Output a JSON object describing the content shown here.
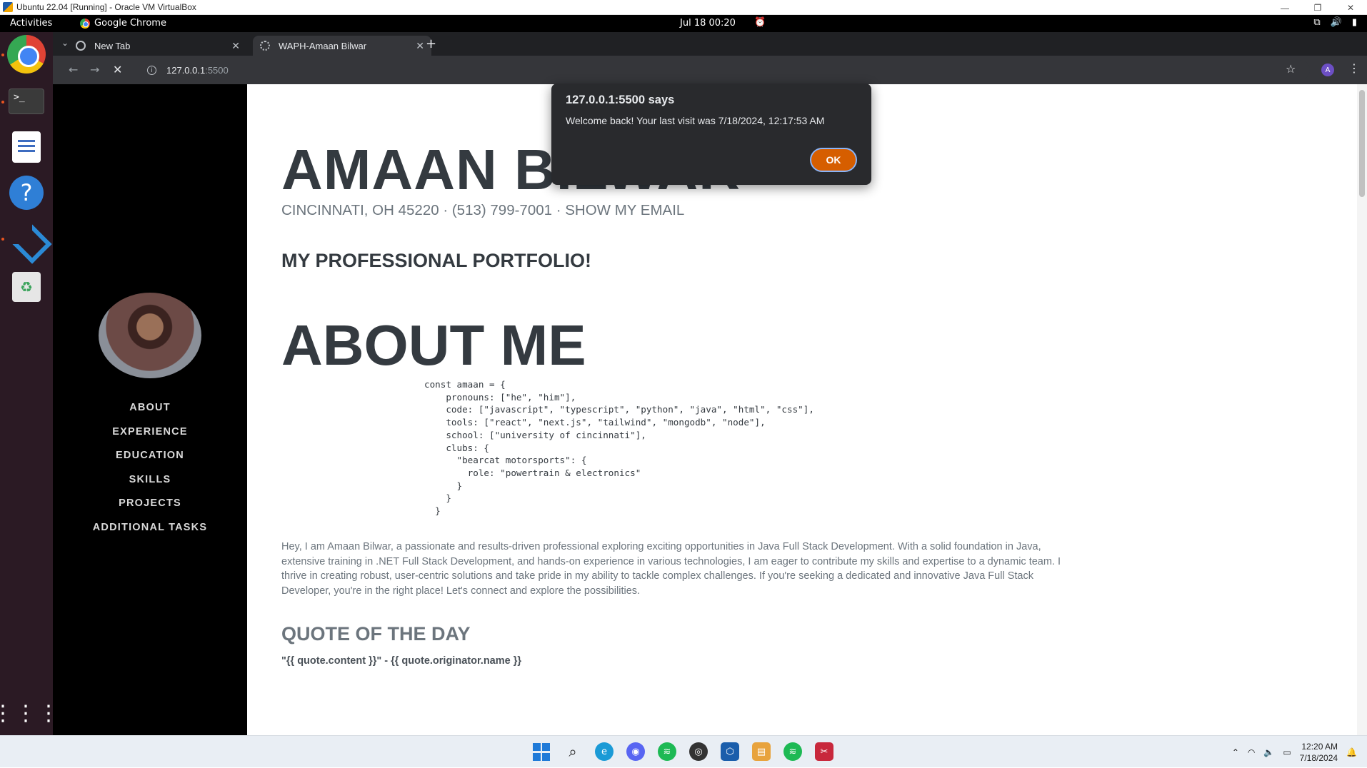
{
  "vbox": {
    "title": "Ubuntu 22.04 [Running] - Oracle VM VirtualBox"
  },
  "gnome": {
    "activities": "Activities",
    "app_name": "Google Chrome",
    "clock": "Jul 18  00:20"
  },
  "dock": {
    "items": [
      "chrome-icon",
      "terminal-icon",
      "text-editor-icon",
      "help-icon",
      "vscode-icon",
      "trash-icon"
    ],
    "show_apps_icon": "app-grid-icon",
    "terminal_glyph": ">_"
  },
  "browser": {
    "tabs": [
      {
        "label": "New Tab",
        "active": false
      },
      {
        "label": "WAPH-Amaan Bilwar",
        "active": true
      }
    ],
    "url_host": "127.0.0.1",
    "url_port": ":5500",
    "profile_initial": "A"
  },
  "page": {
    "name": "AMAAN BILWAR",
    "contact": "CINCINNATI, OH 45220 · (513) 799-7001 · SHOW MY EMAIL",
    "subhead": "MY PROFESSIONAL PORTFOLIO!",
    "about_heading": "ABOUT ME",
    "code": "const amaan = {\n    pronouns: [\"he\", \"him\"],\n    code: [\"javascript\", \"typescript\", \"python\", \"java\", \"html\", \"css\"],\n    tools: [\"react\", \"next.js\", \"tailwind\", \"mongodb\", \"node\"],\n    school: [\"university of cincinnati\"],\n    clubs: {\n      \"bearcat motorsports\": {\n        role: \"powertrain & electronics\"\n      }\n    }\n  }",
    "bio": "Hey, I am Amaan Bilwar, a passionate and results-driven professional exploring exciting opportunities in Java Full Stack Development. With a solid foundation in Java, extensive training in .NET Full Stack Development, and hands-on experience in various technologies, I am eager to contribute my skills and expertise to a dynamic team. I thrive in creating robust, user-centric solutions and take pride in my ability to tackle complex challenges. If you're seeking a dedicated and innovative Java Full Stack Developer, you're in the right place! Let's connect and explore the possibilities.",
    "qotd_heading": "QUOTE OF THE DAY",
    "quote": "\"{{ quote.content }}\" - {{ quote.originator.name }}"
  },
  "sidebar": {
    "nav": [
      "ABOUT",
      "EXPERIENCE",
      "EDUCATION",
      "SKILLS",
      "PROJECTS",
      "ADDITIONAL TASKS"
    ]
  },
  "dialog": {
    "title": "127.0.0.1:5500 says",
    "message": "Welcome back! Your last visit was 7/18/2024, 12:17:53 AM",
    "ok_label": "OK"
  },
  "taskbar": {
    "pinned": [
      "windows-start-icon",
      "search-icon",
      "edge-icon",
      "discord-icon",
      "spotify-icon",
      "obs-icon",
      "virtualbox-icon",
      "file-explorer-icon",
      "spotify-icon",
      "snipping-tool-icon"
    ],
    "time": "12:20 AM",
    "date": "7/18/2024"
  },
  "colors": {
    "accent_ok": "#d65e00",
    "dock_bg": "#2b1a24",
    "heading": "#343a40",
    "muted": "#6c757d"
  }
}
